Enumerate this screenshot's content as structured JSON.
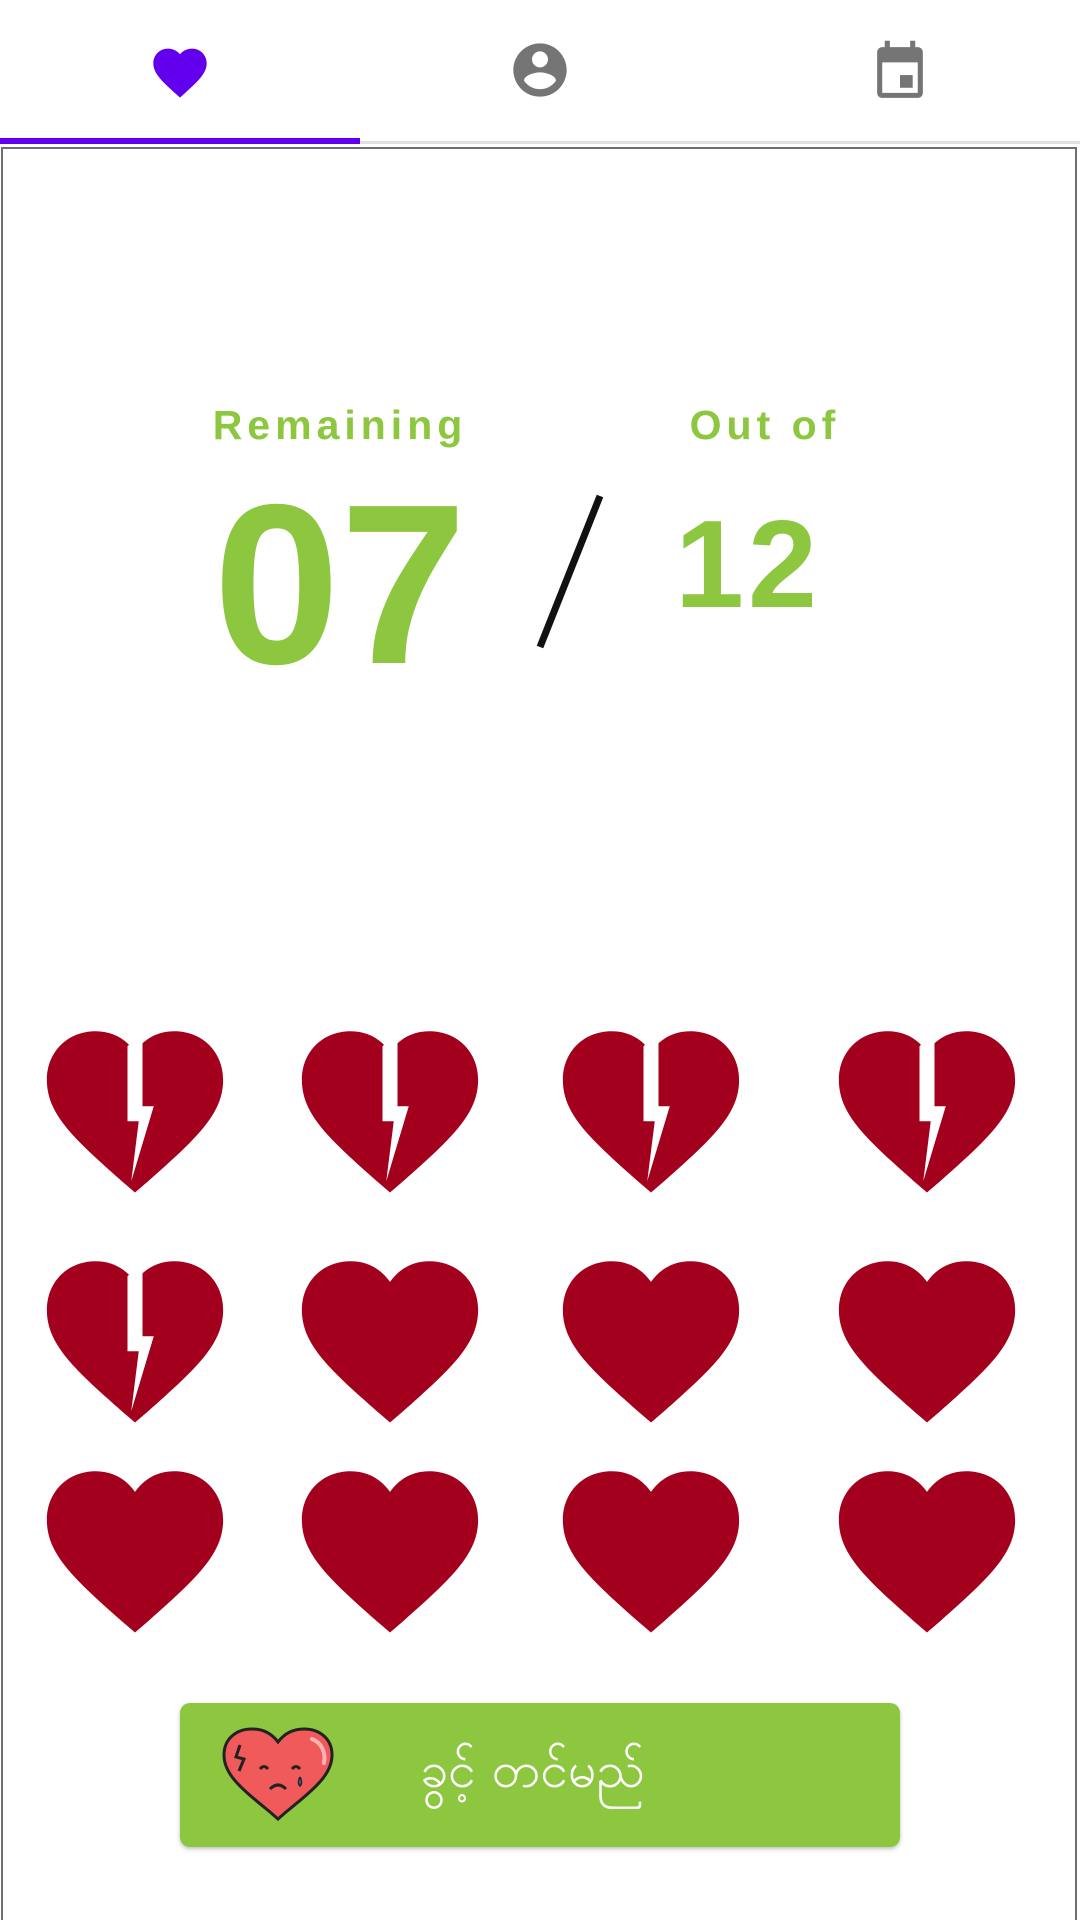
{
  "tabs": [
    {
      "icon": "heart-icon",
      "active": true
    },
    {
      "icon": "account-circle-icon",
      "active": false
    },
    {
      "icon": "calendar-icon",
      "active": false
    }
  ],
  "colors": {
    "accent": "#6200ee",
    "green": "#8dc63f",
    "heart": "#a3001e",
    "tab_inactive": "#757575"
  },
  "counter": {
    "remaining_label": "Remaining",
    "remaining_value": "07",
    "separator": "/",
    "total_label": "Out of",
    "total_value": "12"
  },
  "hearts": {
    "total": 12,
    "broken": 5,
    "items": [
      "broken",
      "broken",
      "broken",
      "broken",
      "broken",
      "whole",
      "whole",
      "whole",
      "whole",
      "whole",
      "whole",
      "whole"
    ]
  },
  "action_button": {
    "label": "ခွင့် တင်မည်",
    "icon": "sad-broken-heart-icon"
  }
}
